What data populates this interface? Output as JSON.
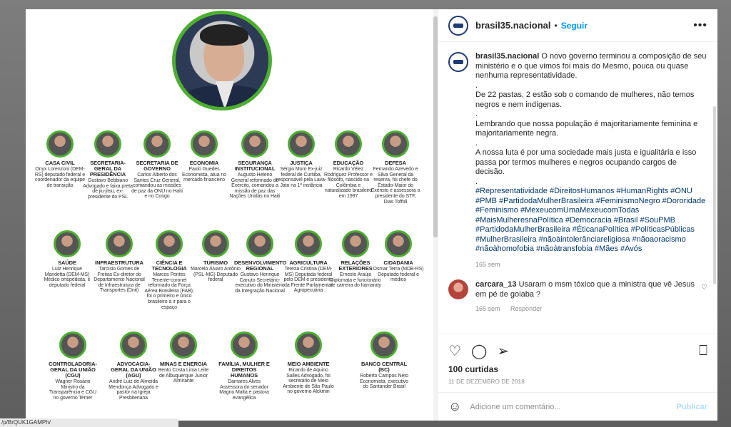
{
  "post": {
    "username": "brasil35.nacional",
    "follow_label": "Seguir",
    "caption_intro": "O novo governo terminou a composição de seu ministério e o que vimos foi mais do Mesmo, pouca ou quase nenhuma representatividade.",
    "p2": "De 22 pastas, 2 estão sob o comando de mulheres, não temos negros e nem indígenas.",
    "p3": "Lembrando que nossa população é majoritariamente feminina e majoritariamente negra.",
    "p4": "A nossa luta é por uma sociedade mais justa e igualitária e isso passa por termos mulheres e negros ocupando cargos de decisão.",
    "hashtags": "#Representatividade #DireitosHumanos #HumanRights #ONU #PMB #PartidodaMulherBrasileira #FeminismoNegro #Dororidade #Feminismo #MexeucomUmaMexeucomTodas #MaisMulheresnaPolítica #Democracia #Brasil #SouPMB #PartidodaMulherBrasileira #ÉticanaPolítica #PolíticasPúblicas #MulherBrasileira #nãoàintolerânciareligiosa #nãoaoracismo #nãoàhomofobia #nãoàtransfobia #Mães #Avós",
    "time": "165 sem",
    "likes": "100 curtidas",
    "date": "11 DE DEZEMBRO DE 2018"
  },
  "comment": {
    "username": "carcara_13",
    "text": "Usaram o msm tóxico que a ministra que vê Jesus em pé de goiaba ?",
    "time": "165 sem",
    "reply": "Responder"
  },
  "composer": {
    "placeholder": "Adicione um comentário...",
    "publish": "Publicar"
  },
  "status_url": "/p/BrQUK1GAMPh/",
  "ministers": [
    {
      "title": "CASA CIVIL",
      "desc": "Onyx Lorenzoni (DEM-RS) deputado federal e coordenador da equipe de transição"
    },
    {
      "title": "SECRETARIA-GERAL DA PRESIDÊNCIA",
      "desc": "Gustavo Bebbiano Advogado e faixa preta de jiu-jitsu, ex-presidente do PSL"
    },
    {
      "title": "SECRETARIA DE GOVERNO",
      "desc": "Carlos Alberto dos Santos Cruz General, comandou as missões de paz da ONU no Haiti e no Congo"
    },
    {
      "title": "ECONOMIA",
      "desc": "Paulo Guedes Economista, atua no mercado financeiro"
    },
    {
      "title": "SEGURANÇA INSTITUCIONAL",
      "desc": "Augusto Heleno General reformado do Exército, comandou a missão de paz das Nações Unidas no Haiti"
    },
    {
      "title": "JUSTIÇA",
      "desc": "Sérgio Moro Ex-juiz federal de Curitiba, responsável pela Lava-Jato na 1ª instância"
    },
    {
      "title": "EDUCAÇÃO",
      "desc": "Ricardo Vélez Rodríguez Professor e filósofo, nascido na Colômbia e naturalizado brasileiro em 1997"
    },
    {
      "title": "DEFESA",
      "desc": "Fernando Azevedo e Silva General da reserva, foi chefe do Estado-Maior do Exército e assessora o presidente do STF, Dias Toffoli"
    },
    {
      "title": "SAÚDE",
      "desc": "Luiz Henrique Mandetta (DEM-MS) Médico ortopedista, é deputado federal"
    },
    {
      "title": "INFRAESTRUTURA",
      "desc": "Tarcísio Gomes de Freitas Ex-diretor do Departamento Nacional de Infraestrutura de Transportes (Dnit)"
    },
    {
      "title": "CIÊNCIA E TECNOLOGIA",
      "desc": "Marcos Pontes Tenente-coronel reformado da Força Aérea Brasileira (FAB), foi o primeiro e único brasileiro a ir para o espaço"
    },
    {
      "title": "TURISMO",
      "desc": "Marcelo Álvaro Antônio (PSL-MG) Deputado federal"
    },
    {
      "title": "DESENVOLVIMENTO REGIONAL",
      "desc": "Gustavo Henrique Canuto Secretário-executivo do Ministério da Integração Nacional"
    },
    {
      "title": "AGRICULTURA",
      "desc": "Tereza Cristina (DEM-MS) Deputada federal pelo DEM e presidente da Frente Parlamentar Agropecuária"
    },
    {
      "title": "RELAÇÕES EXTERIORES",
      "desc": "Ernesto Araújo Diplomata e funcionário de carreira do Itamaraty"
    },
    {
      "title": "CIDADANIA",
      "desc": "Osmar Terra (MDB-RS) Deputado federal e médico"
    },
    {
      "title": "CONTROLADORIA-GERAL DA UNIÃO (CGU)",
      "desc": "Wagner Rosário Ministro da Transparência e CGU no governo Temer"
    },
    {
      "title": "ADVOCACIA-GERAL DA UNIÃO (AGU)",
      "desc": "André Luiz de Almeida Mendonça Advogado e pastor na Igreja Presbiteriana"
    },
    {
      "title": "MINAS E ENERGIA",
      "desc": "Bento Costa Lima Leite de Albuquerque Junior Almirante"
    },
    {
      "title": "FAMÍLIA, MULHER E DIREITOS HUMANOS",
      "desc": "Damares Alves Assessora do senador Magno Malta e pastora evangélica"
    },
    {
      "title": "MEIO AMBIENTE",
      "desc": "Ricardo de Aquino Salles Advogado, foi secretário de Meio Ambiente de São Paulo no governo Alckmin"
    },
    {
      "title": "BANCO CENTRAL (BC)",
      "desc": "Roberto Campos Neto Economista, executivo do Santander Brasil"
    }
  ]
}
